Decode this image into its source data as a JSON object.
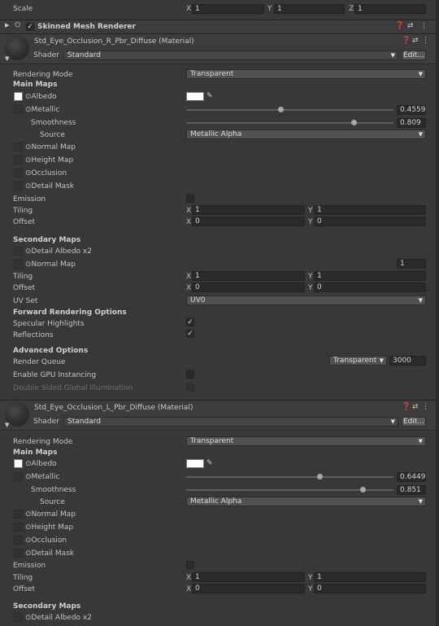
{
  "scale_row": {
    "label": "Scale",
    "x_axis": "X",
    "x": "1",
    "y_axis": "Y",
    "y": "1",
    "z_axis": "Z",
    "z": "1"
  },
  "component": {
    "title": "Skinned Mesh Renderer",
    "help_icon": "question-icon",
    "settings_icon": "sliders-icon",
    "menu_icon": "kebab-icon"
  },
  "materials": [
    {
      "title": "Std_Eye_Occlusion_R_Pbr_Diffuse (Material)",
      "shader_label": "Shader",
      "shader_value": "Standard",
      "edit_label": "Edit...",
      "rendering_mode_label": "Rendering Mode",
      "rendering_mode": "Transparent",
      "main_maps_label": "Main Maps",
      "albedo_label": "Albedo",
      "metallic_label": "Metallic",
      "metallic_value": "0.45599",
      "metallic_fraction": 0.456,
      "smoothness_label": "Smoothness",
      "smoothness_value": "0.809",
      "smoothness_fraction": 0.809,
      "source_label": "Source",
      "source_value": "Metallic Alpha",
      "normal_label": "Normal Map",
      "height_label": "Height Map",
      "occlusion_label": "Occlusion",
      "detail_mask_label": "Detail Mask",
      "emission_label": "Emission",
      "tiling_label": "Tiling",
      "tiling_x": "1",
      "tiling_y": "1",
      "offset_label": "Offset",
      "offset_x": "0",
      "offset_y": "0",
      "secondary_maps_label": "Secondary Maps",
      "detail_albedo_label": "Detail Albedo x2",
      "sec_normal_label": "Normal Map",
      "sec_normal_value": "1",
      "sec_tiling_x": "1",
      "sec_tiling_y": "1",
      "sec_offset_x": "0",
      "sec_offset_y": "0",
      "uv_set_label": "UV Set",
      "uv_set_value": "UV0",
      "forward_label": "Forward Rendering Options",
      "specular_label": "Specular Highlights",
      "reflections_label": "Reflections",
      "advanced_label": "Advanced Options",
      "render_queue_label": "Render Queue",
      "render_queue_mode": "Transparent",
      "render_queue_value": "3000",
      "gpu_instancing_label": "Enable GPU Instancing",
      "double_sided_label": "Double Sided Global Illumination"
    },
    {
      "title": "Std_Eye_Occlusion_L_Pbr_Diffuse (Material)",
      "shader_label": "Shader",
      "shader_value": "Standard",
      "edit_label": "Edit...",
      "rendering_mode_label": "Rendering Mode",
      "rendering_mode": "Transparent",
      "main_maps_label": "Main Maps",
      "albedo_label": "Albedo",
      "metallic_label": "Metallic",
      "metallic_value": "0.64499",
      "metallic_fraction": 0.645,
      "smoothness_label": "Smoothness",
      "smoothness_value": "0.851",
      "smoothness_fraction": 0.851,
      "source_label": "Source",
      "source_value": "Metallic Alpha",
      "normal_label": "Normal Map",
      "height_label": "Height Map",
      "occlusion_label": "Occlusion",
      "detail_mask_label": "Detail Mask",
      "emission_label": "Emission",
      "tiling_label": "Tiling",
      "tiling_x": "1",
      "tiling_y": "1",
      "offset_label": "Offset",
      "offset_x": "0",
      "offset_y": "0",
      "secondary_maps_label": "Secondary Maps",
      "detail_albedo_label": "Detail Albedo x2"
    }
  ],
  "axis": {
    "x": "X",
    "y": "Y"
  },
  "colors": {
    "panel": "#383838",
    "field": "#2a2a2a",
    "header": "#3c3c3c"
  }
}
